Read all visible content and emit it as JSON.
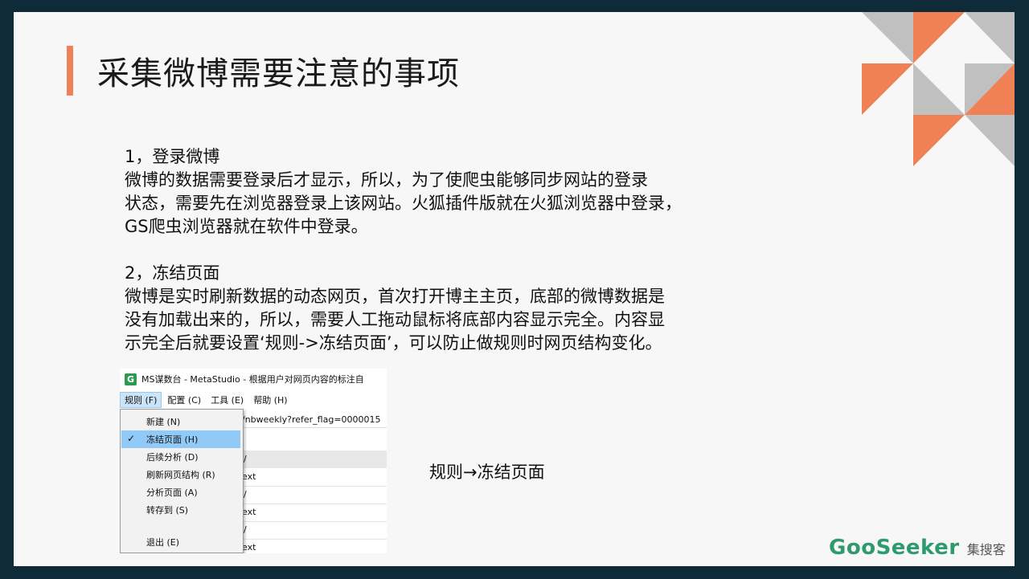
{
  "title": "采集微博需要注意的事项",
  "body": {
    "s1_heading": "1，登录微博",
    "s1_lines": [
      "微博的数据需要登录后才显示，所以，为了使爬虫能够同步网站的登录",
      "状态，需要先在浏览器登录上该网站。火狐插件版就在火狐浏览器中登录，",
      "GS爬虫浏览器就在软件中登录。"
    ],
    "s2_heading": "2，冻结页面",
    "s2_lines": [
      "微博是实时刷新数据的动态网页，首次打开博主主页，底部的微博数据是",
      "没有加载出来的，所以，需要人工拖动鼠标将底部内容显示完全。内容显",
      "示完全后就要设置‘规则->冻结页面’，可以防止做规则时网页结构变化。"
    ]
  },
  "caption": "规则→冻结页面",
  "logo": {
    "text_en": "GooSeeker",
    "text_cn": "集搜客"
  },
  "screenshot": {
    "app_icon": "G",
    "window_title": "MS谋数台 - MetaStudio - 根据用户对网页内容的标注自",
    "menus": [
      "规则 (F)",
      "配置 (C)",
      "工具 (E)",
      "帮助 (H)"
    ],
    "url_fragment": "/nbweekly?refer_flag=0000015",
    "dropdown": [
      {
        "label": "新建 (N)",
        "checked": false,
        "selected": false
      },
      {
        "label": "冻结页面 (H)",
        "checked": true,
        "selected": true
      },
      {
        "label": "后续分析 (D)",
        "checked": false,
        "selected": false
      },
      {
        "label": "刷新网页结构 (R)",
        "checked": false,
        "selected": false
      },
      {
        "label": "分析页面 (A)",
        "checked": false,
        "selected": false
      },
      {
        "label": "转存到 (S)",
        "checked": false,
        "selected": false
      },
      {
        "label": "退出 (E)",
        "checked": false,
        "selected": false
      }
    ],
    "grid_fragments": [
      "/",
      "ext",
      "/",
      "ext",
      "/",
      "ext"
    ]
  },
  "colors": {
    "accent": "#f08157",
    "frame": "#0f2b3a",
    "logo_green": "#2e9a6e",
    "menu_highlight": "#91c9f7"
  }
}
